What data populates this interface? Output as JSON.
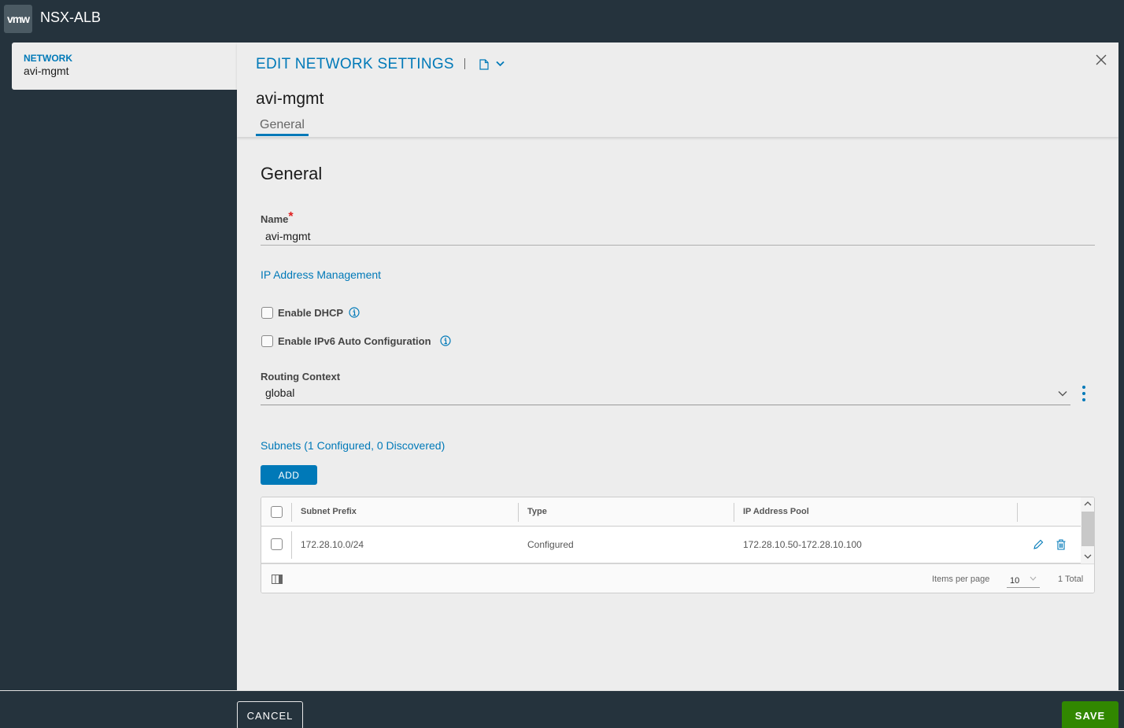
{
  "app": {
    "logo_text": "vmw",
    "title": "NSX-ALB"
  },
  "breadcrumb": {
    "object_type": "NETWORK",
    "object_name": "avi-mgmt"
  },
  "modal": {
    "title": "EDIT NETWORK SETTINGS",
    "object_name": "avi-mgmt",
    "tabs": [
      {
        "label": "General",
        "active": true
      }
    ]
  },
  "form": {
    "section_title": "General",
    "name": {
      "label": "Name",
      "required_marker": "*",
      "value": "avi-mgmt"
    },
    "ipam_heading": "IP Address Management",
    "enable_dhcp": {
      "label": "Enable DHCP",
      "checked": false
    },
    "enable_ipv6": {
      "label": "Enable IPv6 Auto Configuration",
      "checked": false
    },
    "routing_context": {
      "label": "Routing Context",
      "value": "global"
    },
    "subnets_heading": "Subnets (1 Configured, 0 Discovered)",
    "add_label": "ADD"
  },
  "subnets_table": {
    "columns": [
      "Subnet Prefix",
      "Type",
      "IP Address Pool"
    ],
    "rows": [
      {
        "subnet_prefix": "172.28.10.0/24",
        "type": "Configured",
        "ip_address_pool": "172.28.10.50-172.28.10.100"
      }
    ],
    "items_per_page_label": "Items per page",
    "items_per_page": "10",
    "total": "1 Total"
  },
  "footer": {
    "cancel_label": "CANCEL",
    "save_label": "SAVE"
  },
  "colors": {
    "accent": "#0079b8",
    "save": "#318700",
    "chrome": "#25333d"
  }
}
